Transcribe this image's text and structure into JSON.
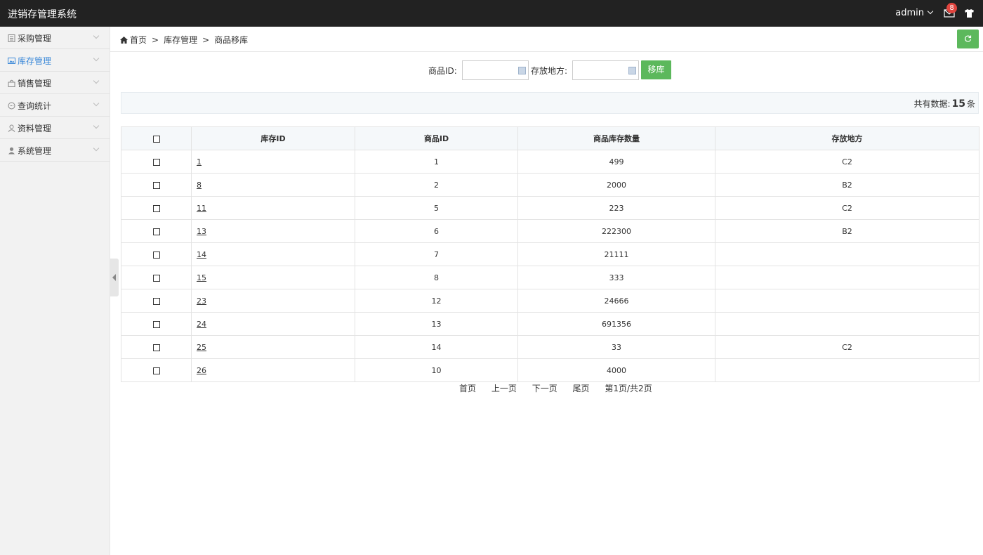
{
  "app": {
    "title": "进销存管理系统"
  },
  "header": {
    "user": "admin",
    "mail_badge": "8"
  },
  "sidebar": {
    "items": [
      {
        "label": "采购管理",
        "icon": "document-icon"
      },
      {
        "label": "库存管理",
        "icon": "image-icon",
        "active": true
      },
      {
        "label": "销售管理",
        "icon": "bag-icon"
      },
      {
        "label": "查询统计",
        "icon": "chat-icon"
      },
      {
        "label": "资料管理",
        "icon": "user-outline-icon"
      },
      {
        "label": "系统管理",
        "icon": "user-icon"
      }
    ]
  },
  "breadcrumb": {
    "home": "首页",
    "sep": ">",
    "level1": "库存管理",
    "level2": "商品移库"
  },
  "search": {
    "product_id_label": "商品ID:",
    "location_label": "存放地方:",
    "submit_label": "移库"
  },
  "summary": {
    "prefix": "共有数据:",
    "count": "15",
    "unit": "条"
  },
  "table": {
    "columns": [
      "库存ID",
      "商品ID",
      "商品库存数量",
      "存放地方"
    ],
    "rows": [
      {
        "stock_id": "1",
        "product_id": "1",
        "qty": "499",
        "location": "C2"
      },
      {
        "stock_id": "8",
        "product_id": "2",
        "qty": "2000",
        "location": "B2"
      },
      {
        "stock_id": "11",
        "product_id": "5",
        "qty": "223",
        "location": "C2"
      },
      {
        "stock_id": "13",
        "product_id": "6",
        "qty": "222300",
        "location": "B2"
      },
      {
        "stock_id": "14",
        "product_id": "7",
        "qty": "21111",
        "location": ""
      },
      {
        "stock_id": "15",
        "product_id": "8",
        "qty": "333",
        "location": ""
      },
      {
        "stock_id": "23",
        "product_id": "12",
        "qty": "24666",
        "location": ""
      },
      {
        "stock_id": "24",
        "product_id": "13",
        "qty": "691356",
        "location": ""
      },
      {
        "stock_id": "25",
        "product_id": "14",
        "qty": "33",
        "location": "C2"
      },
      {
        "stock_id": "26",
        "product_id": "10",
        "qty": "4000",
        "location": ""
      }
    ]
  },
  "pager": {
    "first": "首页",
    "prev": "上一页",
    "next": "下一页",
    "last": "尾页",
    "info": "第1页/共2页"
  },
  "colors": {
    "topbar": "#222222",
    "accent": "#5cb85c",
    "active_link": "#3a88d8",
    "badge": "#e0443e"
  }
}
